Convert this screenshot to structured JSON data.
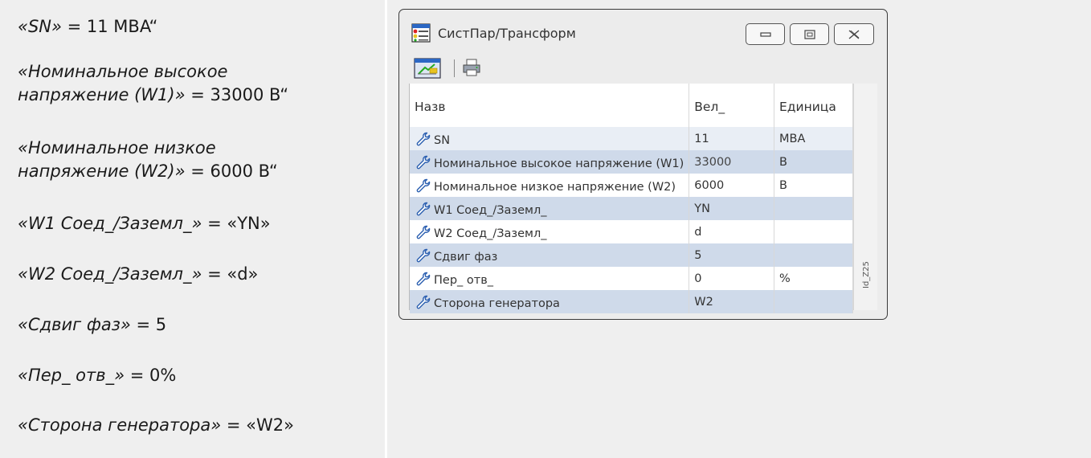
{
  "left_text": [
    {
      "label": "«SN»",
      "value": " = 11 MBA“"
    },
    {
      "label": "«Номинальное высокое",
      "value": ""
    },
    {
      "label": "напряжение (W1)»",
      "value": " = 33000 B“"
    },
    {
      "label": "«Номинальное низкое",
      "value": ""
    },
    {
      "label": "напряжение (W2)»",
      "value": " = 6000 B“"
    },
    {
      "label": "«W1 Соед_/Заземл_»",
      "value": " = «YN»"
    },
    {
      "label": "«W2 Соед_/Заземл_»",
      "value": " = «d»"
    },
    {
      "label": "«Сдвиг фаз»",
      "value": " = 5"
    },
    {
      "label": "«Пер_ отв_»",
      "value": " = 0%"
    },
    {
      "label": "«Сторона генератора»",
      "value": " = «W2»"
    }
  ],
  "window": {
    "title": "СистПар/Трансформ",
    "side_id": "Id_Z25"
  },
  "table": {
    "headers": [
      "Назв",
      "Вел_",
      "Единица"
    ],
    "rows": [
      {
        "name": "SN",
        "value": "11",
        "unit": "MBA"
      },
      {
        "name": "Номинальное высокое напряжение (W1)",
        "value": "33000",
        "unit": "B"
      },
      {
        "name": "Номинальное низкое напряжение (W2)",
        "value": "6000",
        "unit": "B"
      },
      {
        "name": "W1 Соед_/Заземл_",
        "value": "YN",
        "unit": ""
      },
      {
        "name": "W2 Соед_/Заземл_",
        "value": "d",
        "unit": ""
      },
      {
        "name": "Сдвиг фаз",
        "value": "5",
        "unit": ""
      },
      {
        "name": "Пер_ отв_",
        "value": "0",
        "unit": "%"
      },
      {
        "name": "Сторона генератора",
        "value": "W2",
        "unit": ""
      }
    ]
  }
}
